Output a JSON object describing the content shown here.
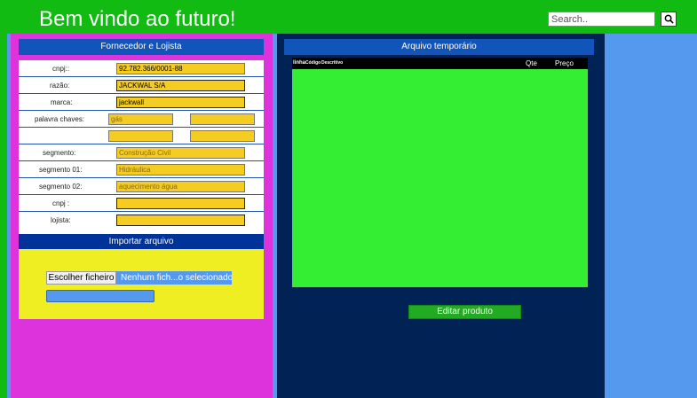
{
  "header": {
    "title": "Bem vindo ao futuro!",
    "search_placeholder": "Search.."
  },
  "supplier": {
    "title": "Fornecedor e Lojista",
    "rows": [
      {
        "label": "cnpj::",
        "value": "92.782.366/0001-88"
      },
      {
        "label": "razão:",
        "value": "JACKWAL S/A"
      },
      {
        "label": "marca:",
        "value": "jackwall"
      },
      {
        "label": "palavra chaves:",
        "value": "gás",
        "value2": ""
      },
      {
        "label": "",
        "value": "",
        "value2": ""
      },
      {
        "label": "segmento:",
        "value": "Construção Civil"
      },
      {
        "label": "segmento 01:",
        "value": "Hidráulica"
      },
      {
        "label": "segmento 02:",
        "value": "aquecimento água"
      },
      {
        "label": "cnpj :",
        "value": ""
      },
      {
        "label": "lojista:",
        "value": ""
      }
    ],
    "import_label": "Importar arquivo",
    "file_button": "Escolher ficheiro",
    "file_status": "Nenhum fich...o selecionado"
  },
  "temp": {
    "title": "Arquivo temporário",
    "columns": {
      "linha": "linha",
      "codigo": "Código",
      "descritivo": "Descritivo",
      "qtd": "Qte",
      "preco": "Preço"
    },
    "edit_button": "Editar produto"
  },
  "colors": {
    "header": "#11bb11",
    "left_panel": "#dd33dd",
    "center_panel": "#002255",
    "right_panel": "#5599ee",
    "field": "#f5cc22",
    "table": "#33ee33"
  }
}
